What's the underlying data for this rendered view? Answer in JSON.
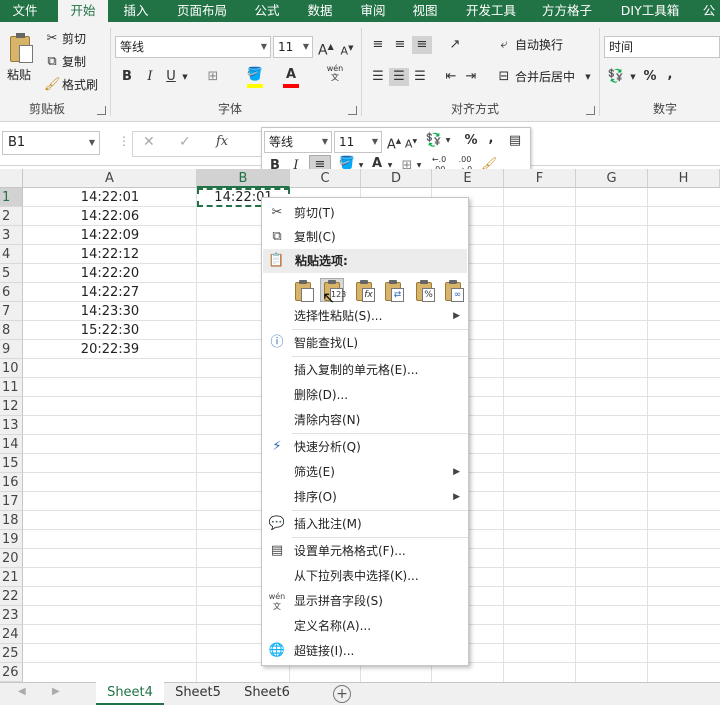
{
  "ribbon_tabs": [
    "文件",
    "开始",
    "插入",
    "页面布局",
    "公式",
    "数据",
    "审阅",
    "视图",
    "开发工具",
    "方方格子",
    "DIY工具箱",
    "公"
  ],
  "active_tab": "开始",
  "clipboard": {
    "paste": "粘贴",
    "cut": "剪切",
    "copy": "复制",
    "format_painter": "格式刷",
    "group_label": "剪贴板"
  },
  "font": {
    "name": "等线",
    "size": "11",
    "group_label": "字体",
    "bold": "B",
    "italic": "I",
    "underline": "U",
    "grow": "A",
    "shrink": "A",
    "color_letter": "A",
    "phonetic": "wén"
  },
  "alignment": {
    "wrap": "自动换行",
    "merge": "合并后居中",
    "group_label": "对齐方式"
  },
  "number": {
    "format": "时间",
    "percent": "%",
    "comma": ",",
    "group_label": "数字"
  },
  "formula_bar": {
    "name_box": "B1",
    "fx": "fx",
    "cancel": "✕",
    "enter": "✓"
  },
  "grid": {
    "columns": [
      "A",
      "B",
      "C",
      "D",
      "E",
      "F",
      "G",
      "H"
    ],
    "rows": [
      "1",
      "2",
      "3",
      "4",
      "5",
      "6",
      "7",
      "8",
      "9",
      "10",
      "11",
      "12",
      "13",
      "14",
      "15",
      "16",
      "17",
      "18",
      "19",
      "20",
      "21",
      "22",
      "23",
      "24",
      "25",
      "26"
    ],
    "column_a": [
      "14:22:01",
      "14:22:06",
      "14:22:09",
      "14:22:12",
      "14:22:20",
      "14:22:27",
      "14:23:30",
      "15:22:30",
      "20:22:39"
    ],
    "b1": "14:22:01",
    "selected_cell": "B1"
  },
  "sheet_tabs": [
    "Sheet4",
    "Sheet5",
    "Sheet6"
  ],
  "active_sheet": "Sheet4",
  "mini_toolbar": {
    "font": "等线",
    "size": "11",
    "percent": "%",
    "comma": ",",
    "bold": "B",
    "italic": "I",
    "dec_inc": "←.0 .00",
    "dec_dec": ".00 →.0"
  },
  "context_menu": {
    "cut": "剪切(T)",
    "copy": "复制(C)",
    "paste_options": "粘贴选项:",
    "paste_special": "选择性粘贴(S)...",
    "smart_lookup": "智能查找(L)",
    "insert_copied": "插入复制的单元格(E)...",
    "delete": "删除(D)...",
    "clear": "清除内容(N)",
    "quick_analysis": "快速分析(Q)",
    "filter": "筛选(E)",
    "sort": "排序(O)",
    "insert_comment": "插入批注(M)",
    "format_cells": "设置单元格格式(F)...",
    "pick_list": "从下拉列表中选择(K)...",
    "phonetic": "显示拼音字段(S)",
    "define_name": "定义名称(A)...",
    "hyperlink": "超链接(I)...",
    "paste_icons": [
      "",
      "123",
      "fx",
      "⇄",
      "%",
      "∞"
    ]
  },
  "colors": {
    "excel_green": "#217346",
    "highlight_yellow": "#ffff00",
    "font_red": "#ff0000"
  }
}
